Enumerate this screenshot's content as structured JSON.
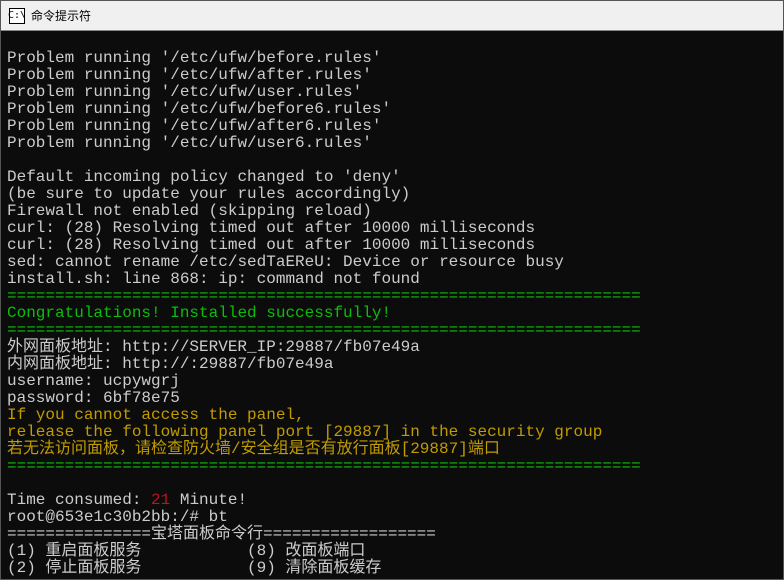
{
  "titlebar": {
    "icon_label": "C:\\",
    "title": "命令提示符"
  },
  "lines": {
    "l1": "Problem running '/etc/ufw/before.rules'",
    "l2": "Problem running '/etc/ufw/after.rules'",
    "l3": "Problem running '/etc/ufw/user.rules'",
    "l4": "Problem running '/etc/ufw/before6.rules'",
    "l5": "Problem running '/etc/ufw/after6.rules'",
    "l6": "Problem running '/etc/ufw/user6.rules'",
    "l7": "Default incoming policy changed to 'deny'",
    "l8": "(be sure to update your rules accordingly)",
    "l9": "Firewall not enabled (skipping reload)",
    "l10": "curl: (28) Resolving timed out after 10000 milliseconds",
    "l11": "curl: (28) Resolving timed out after 10000 milliseconds",
    "l12": "sed: cannot rename /etc/sedTaEReU: Device or resource busy",
    "l13": "install.sh: line 868: ip: command not found",
    "sep": "==================================================================",
    "congrats": "Congratulations! Installed successfully!",
    "addr_ext": "外网面板地址: http://SERVER_IP:29887/fb07e49a",
    "addr_int": "内网面板地址: http://:29887/fb07e49a",
    "user": "username: ucpywgrj",
    "pass": "password: 6bf78e75",
    "warn1": "If you cannot access the panel,",
    "warn2": "release the following panel port [29887] in the security group",
    "warn3": "若无法访问面板，请检查防火墙/安全组是否有放行面板[29887]端口",
    "time_label": "Time consumed: ",
    "time_value": "21",
    "time_suffix": " Minute!",
    "prompt": "root@653e1c30b2bb:/# ",
    "cmd": "bt",
    "menu_sep": "===============宝塔面板命令行==================",
    "menu1": "(1) 重启面板服务           (8) 改面板端口",
    "menu2": "(2) 停止面板服务           (9) 清除面板缓存"
  }
}
